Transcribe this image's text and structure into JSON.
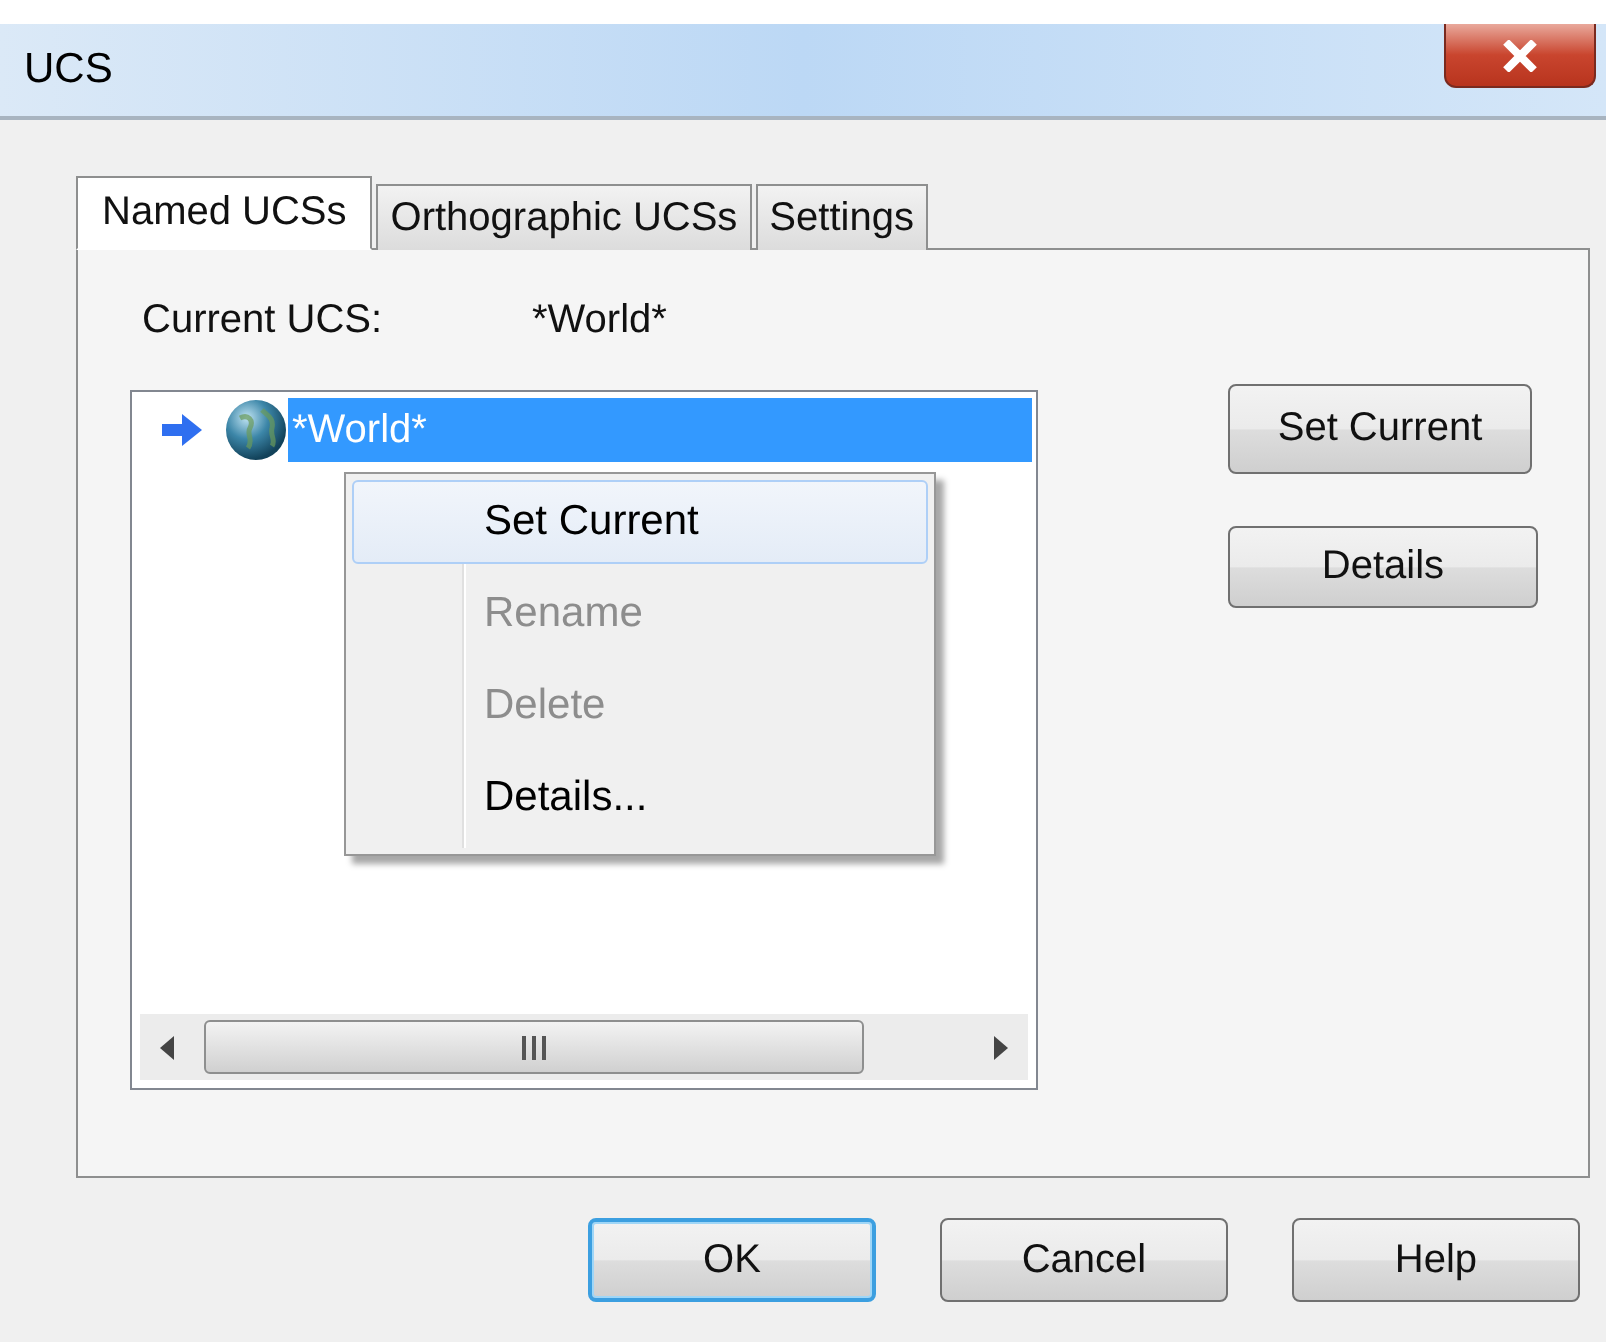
{
  "window": {
    "title": "UCS"
  },
  "tabs": [
    {
      "label": "Named UCSs",
      "selected": true
    },
    {
      "label": "Orthographic UCSs",
      "selected": false
    },
    {
      "label": "Settings",
      "selected": false
    }
  ],
  "current_ucs": {
    "label": "Current UCS:",
    "value": "*World*"
  },
  "ucs_list": [
    {
      "name": "*World*",
      "current": true,
      "selected": true
    }
  ],
  "side_buttons": [
    {
      "label": "Set Current"
    },
    {
      "label": "Details"
    }
  ],
  "context_menu": [
    {
      "label": "Set Current",
      "disabled": false,
      "selected": true
    },
    {
      "label": "Rename",
      "disabled": true,
      "selected": false
    },
    {
      "label": "Delete",
      "disabled": true,
      "selected": false
    },
    {
      "label": "Details...",
      "disabled": false,
      "selected": false
    }
  ],
  "buttons": [
    {
      "label": "OK",
      "default": true
    },
    {
      "label": "Cancel",
      "default": false
    },
    {
      "label": "Help",
      "default": false
    }
  ]
}
